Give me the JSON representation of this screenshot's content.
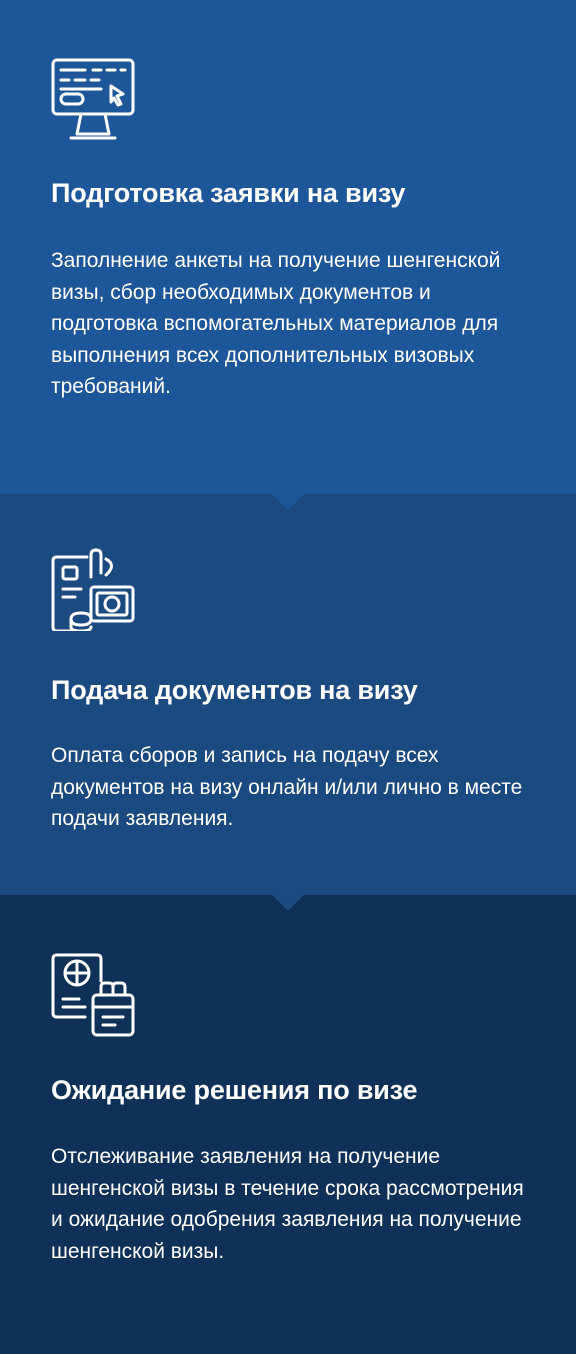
{
  "steps": [
    {
      "icon": "computer-form-icon",
      "title": "Подготовка заявки на визу",
      "description": "Заполнение анкеты на получение шенгенской визы, сбор необходимых документов и подготовка вспомогательных материалов для выполнения всех дополнительных визовых требований."
    },
    {
      "icon": "documents-payment-icon",
      "title": "Подача документов на визу",
      "description": "Оплата сборов и запись на подачу всех документов на визу онлайн и/или лично в месте подачи заявления."
    },
    {
      "icon": "passport-calendar-icon",
      "title": "Ожидание решения по визе",
      "description": "Отслеживание заявления на получение шенгенской визы в течение срока рассмотрения и ожидание одобрения заявления на получение шенгенской визы."
    }
  ],
  "colors": {
    "step1_bg": "#1e5799",
    "step2_bg": "#1b4a80",
    "step3_bg": "#0f3057",
    "text": "#ffffff"
  }
}
